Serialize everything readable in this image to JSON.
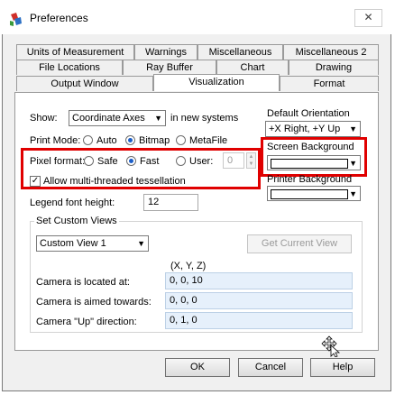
{
  "window": {
    "title": "Preferences",
    "close_glyph": "✕"
  },
  "tabs": {
    "row1": [
      "Units of Measurement",
      "Warnings",
      "Miscellaneous",
      "Miscellaneous 2"
    ],
    "row2": [
      "File Locations",
      "Ray Buffer",
      "Chart",
      "Drawing"
    ],
    "row3": [
      "Output Window",
      "Visualization",
      "Format"
    ],
    "active": "Visualization"
  },
  "visualization": {
    "show_label": "Show:",
    "show_value": "Coordinate Axes",
    "show_suffix": "in new systems",
    "print_mode_label": "Print Mode:",
    "print_mode_options": [
      "Auto",
      "Bitmap",
      "MetaFile"
    ],
    "print_mode_selected": "Bitmap",
    "pixel_format_label": "Pixel format:",
    "pixel_format_options": [
      "Safe",
      "Fast",
      "User:"
    ],
    "pixel_format_selected": "Fast",
    "user_value": "0",
    "multithread_label": "Allow multi-threaded tessellation",
    "multithread_checked": true,
    "legend_font_label": "Legend font height:",
    "legend_font_value": "12",
    "default_orientation_label": "Default Orientation",
    "default_orientation_value": "+X Right, +Y Up",
    "screen_background_label": "Screen Background",
    "printer_background_label": "Printer Background"
  },
  "custom_views": {
    "group_label": "Set Custom Views",
    "view_value": "Custom View 1",
    "get_current_label": "Get Current View",
    "xyz_header": "(X, Y, Z)",
    "camera_location_label": "Camera is located at:",
    "camera_location_value": "0,  0,  10",
    "camera_aimed_label": "Camera is aimed towards:",
    "camera_aimed_value": "0,  0,  0",
    "camera_up_label": "Camera \"Up\" direction:",
    "camera_up_value": "0,  1,  0"
  },
  "buttons": {
    "ok": "OK",
    "cancel": "Cancel",
    "help": "Help"
  },
  "colors": {
    "highlight_box": "#e00000",
    "radio_dot": "#1b5ec8"
  }
}
